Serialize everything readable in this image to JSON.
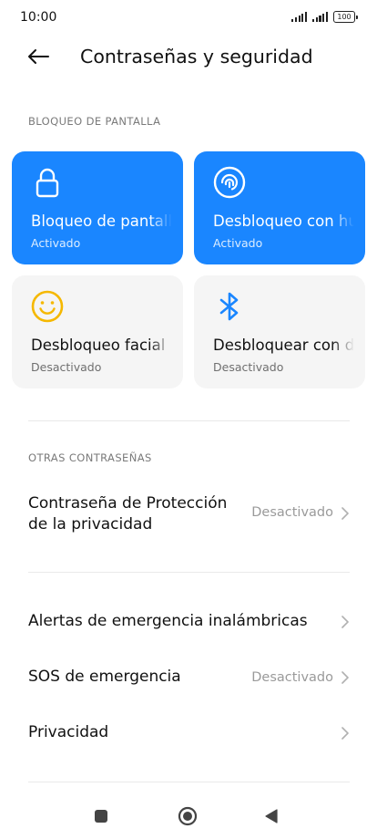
{
  "status": {
    "time": "10:00",
    "battery": "100"
  },
  "header": {
    "title": "Contraseñas y seguridad",
    "back_icon": "arrow-left-icon"
  },
  "screen_lock": {
    "section_label": "BLOQUEO DE PANTALLA",
    "tiles": [
      {
        "title": "Bloqueo de pantalla",
        "status": "Activado",
        "icon": "lock-icon",
        "active": true
      },
      {
        "title": "Desbloqueo con huella dactilar",
        "status": "Activado",
        "icon": "fingerprint-icon",
        "active": true
      },
      {
        "title": "Desbloqueo facial",
        "status": "Desactivado",
        "icon": "smiley-face-icon",
        "active": false
      },
      {
        "title": "Desbloquear con dispositivo Bluetooth",
        "status": "Desactivado",
        "icon": "bluetooth-icon",
        "active": false
      }
    ]
  },
  "other_passwords": {
    "section_label": "OTRAS CONTRASEÑAS",
    "privacy_password": {
      "title_line1": "Contraseña de Protección",
      "title_line2": "de la privacidad",
      "value": "Desactivado"
    }
  },
  "list": {
    "emergency_alerts": {
      "title": "Alertas de emergencia inalámbricas"
    },
    "sos": {
      "title": "SOS de emergencia",
      "value": "Desactivado"
    },
    "privacy": {
      "title": "Privacidad"
    }
  },
  "colors": {
    "accent": "#1a86ff",
    "face_icon": "#f5b800",
    "bluetooth_icon": "#1a86ff"
  }
}
